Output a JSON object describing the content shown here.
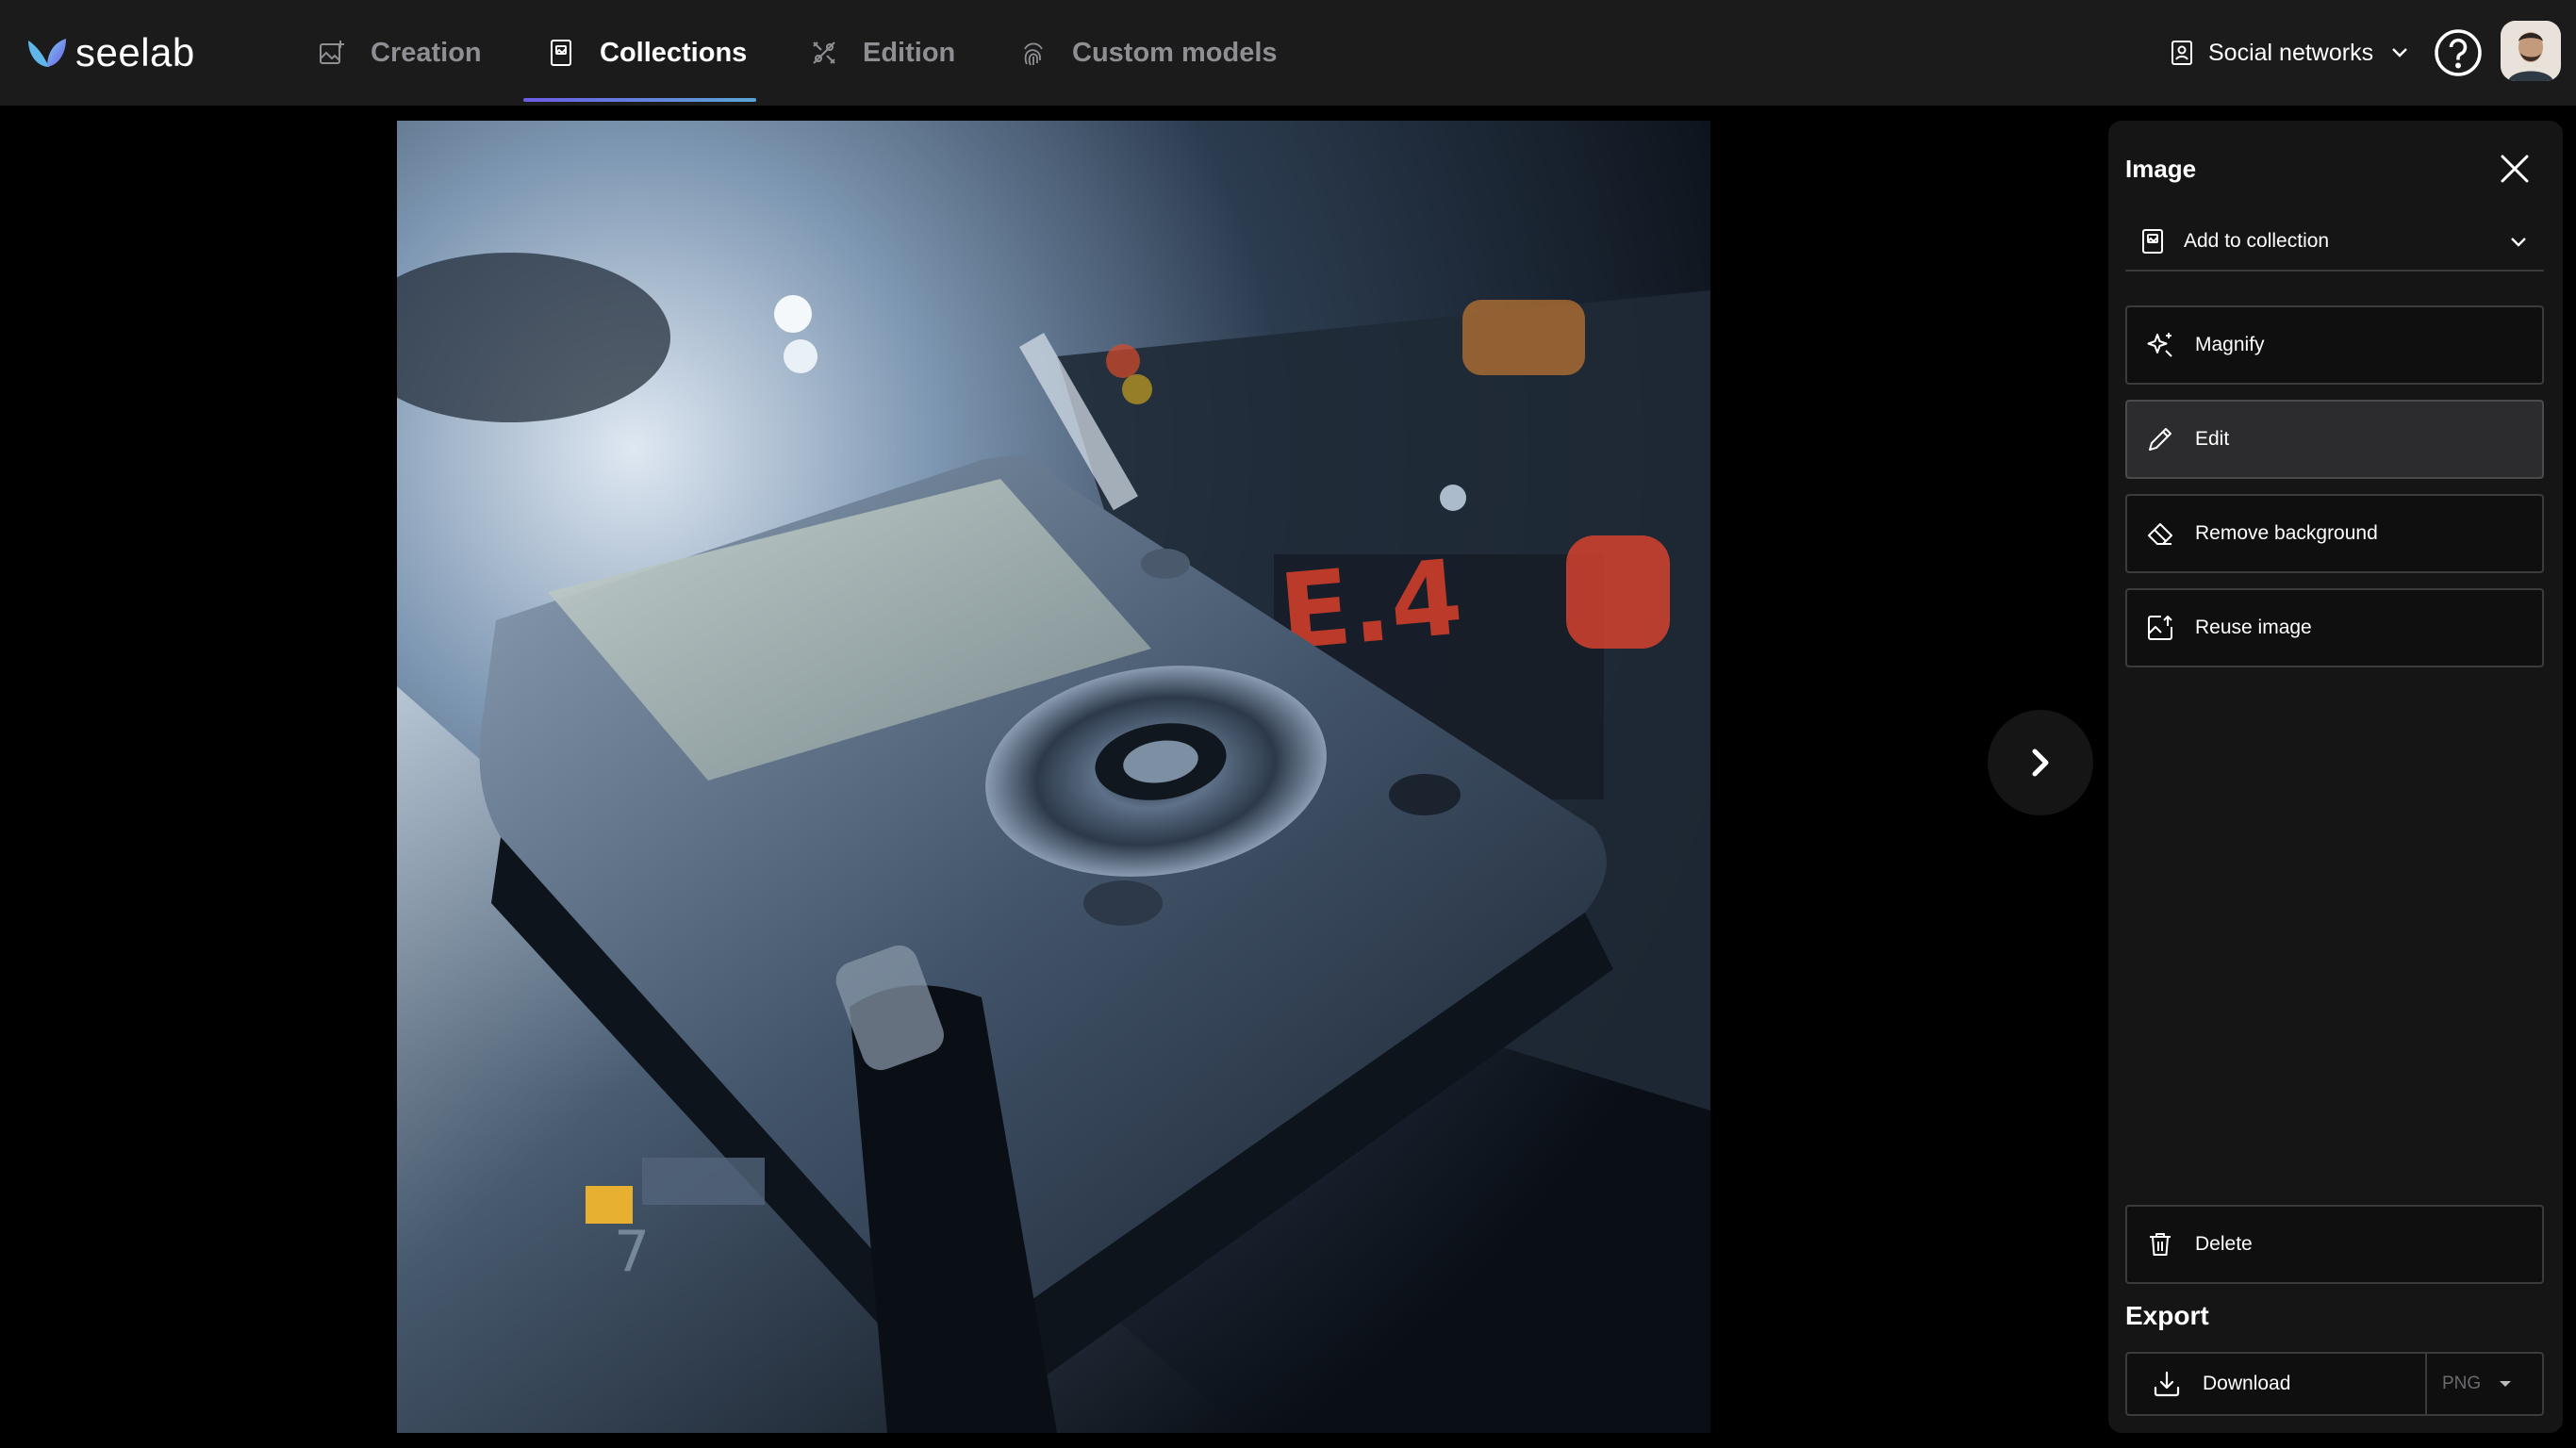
{
  "app": {
    "brand": "seelab",
    "accent_gradient": [
      "#6c5ce7",
      "#5aa6d6"
    ]
  },
  "nav": {
    "tabs": [
      {
        "label": "Creation",
        "icon": "image-plus-icon",
        "active": false
      },
      {
        "label": "Collections",
        "icon": "collection-icon",
        "active": true
      },
      {
        "label": "Edition",
        "icon": "edition-tools-icon",
        "active": false
      },
      {
        "label": "Custom models",
        "icon": "fingerprint-icon",
        "active": false
      }
    ],
    "workspace": {
      "label": "Social networks",
      "icon": "workspace-icon"
    },
    "help_icon": "help-icon"
  },
  "viewer": {
    "next_icon": "chevron-right-icon"
  },
  "panel": {
    "title": "Image",
    "collection_select": {
      "label": "Add to collection",
      "icon": "collection-icon"
    },
    "actions": [
      {
        "label": "Magnify",
        "icon": "sparkles-icon"
      },
      {
        "label": "Edit",
        "icon": "pencil-icon"
      },
      {
        "label": "Remove background",
        "icon": "eraser-icon"
      },
      {
        "label": "Reuse image",
        "icon": "reuse-image-icon"
      }
    ],
    "delete": {
      "label": "Delete",
      "icon": "trash-icon"
    },
    "export": {
      "title": "Export",
      "download_label": "Download",
      "format": "PNG"
    }
  }
}
